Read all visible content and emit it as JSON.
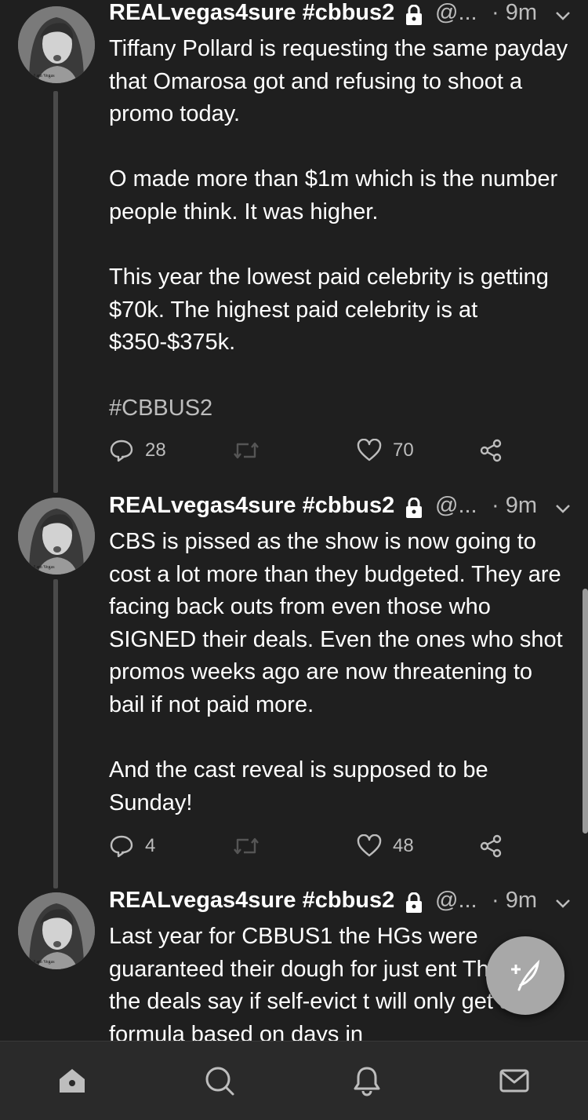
{
  "tweets": [
    {
      "name": "REALvegas4sure #cbbus2",
      "handle": "@...",
      "time": "· 9m",
      "paragraphs": [
        "Tiffany Pollard is requesting the same payday that Omarosa got and refusing to shoot a promo today.",
        "O made more than $1m which is the number people think. It was higher.",
        "This year the lowest paid celebrity is getting $70k. The highest paid celebrity is at $350-$375k.",
        "#CBBUS2"
      ],
      "replies": "28",
      "retweets": "",
      "likes": "70"
    },
    {
      "name": "REALvegas4sure #cbbus2",
      "handle": "@...",
      "time": "· 9m",
      "paragraphs": [
        "CBS is pissed as the show is now going to cost a lot more than they budgeted. They are facing back outs from even those who SIGNED their deals. Even the ones who shot promos weeks ago are now threatening to bail if not paid more.",
        "And the cast reveal is supposed to be Sunday!"
      ],
      "replies": "4",
      "retweets": "",
      "likes": "48"
    },
    {
      "name": "REALvegas4sure #cbbus2",
      "handle": "@...",
      "time": "· 9m",
      "paragraphs": [
        "Last year for CBBUS1 the HGs were guaranteed their dough for just ent This year the deals say if self-evict t will only get a formula based on days in"
      ]
    }
  ],
  "avatar_caption": "I am Vegas",
  "icons": {
    "reply": "reply-icon",
    "retweet": "retweet-icon",
    "like": "heart-icon",
    "share": "share-icon",
    "lock": "lock-icon",
    "caret": "chevron-down-icon",
    "compose": "compose-icon",
    "home": "home-icon",
    "search": "search-icon",
    "notifications": "bell-icon",
    "messages": "mail-icon"
  },
  "colors": {
    "background": "#1f1f1f",
    "text": "#ffffff",
    "muted": "#bdbdbd",
    "fab": "#a8a8a8"
  }
}
